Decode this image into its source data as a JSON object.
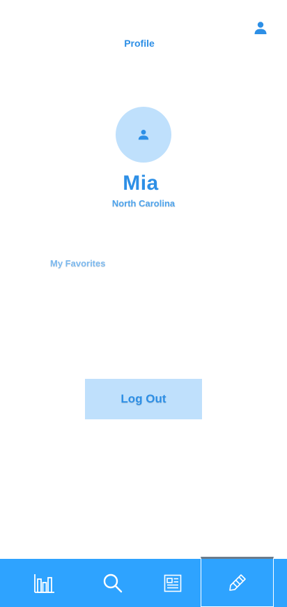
{
  "header": {
    "title": "Profile",
    "user_icon": "person-icon"
  },
  "profile": {
    "avatar_icon": "person-icon",
    "name": "Mia",
    "location": "North Carolina"
  },
  "favorites": {
    "label": "My Favorites"
  },
  "actions": {
    "logout_label": "Log Out"
  },
  "bottom_nav": {
    "items": [
      {
        "icon": "bar-chart-icon",
        "active": false
      },
      {
        "icon": "search-icon",
        "active": false
      },
      {
        "icon": "newspaper-icon",
        "active": false
      },
      {
        "icon": "pencil-icon",
        "active": true
      }
    ]
  },
  "colors": {
    "accent": "#2d8fe6",
    "light_accent": "#bfe0fc",
    "nav_background": "#2ea3ff"
  }
}
